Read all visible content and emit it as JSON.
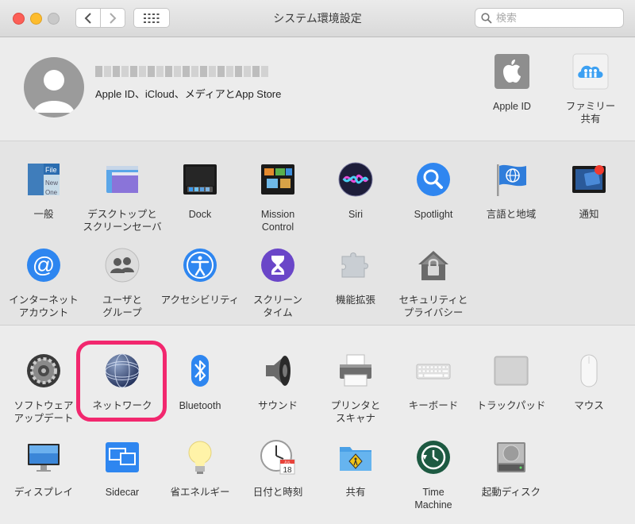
{
  "window": {
    "title": "システム環境設定"
  },
  "toolbar": {
    "search_placeholder": "検索"
  },
  "account": {
    "subtitle": "Apple ID、iCloud、メディアとApp Store",
    "items": [
      {
        "label": "Apple ID"
      },
      {
        "label": "ファミリー\n共有"
      }
    ]
  },
  "section1": [
    {
      "label": "一般"
    },
    {
      "label": "デスクトップと\nスクリーンセーバ"
    },
    {
      "label": "Dock"
    },
    {
      "label": "Mission\nControl"
    },
    {
      "label": "Siri"
    },
    {
      "label": "Spotlight"
    },
    {
      "label": "言語と地域"
    },
    {
      "label": "通知"
    },
    {
      "label": "インターネット\nアカウント"
    },
    {
      "label": "ユーザと\nグループ"
    },
    {
      "label": "アクセシビリティ"
    },
    {
      "label": "スクリーン\nタイム"
    },
    {
      "label": "機能拡張"
    },
    {
      "label": "セキュリティと\nプライバシー"
    }
  ],
  "section2": [
    {
      "label": "ソフトウェア\nアップデート"
    },
    {
      "label": "ネットワーク"
    },
    {
      "label": "Bluetooth"
    },
    {
      "label": "サウンド"
    },
    {
      "label": "プリンタと\nスキャナ"
    },
    {
      "label": "キーボード"
    },
    {
      "label": "トラックパッド"
    },
    {
      "label": "マウス"
    },
    {
      "label": "ディスプレイ"
    },
    {
      "label": "Sidecar"
    },
    {
      "label": "省エネルギー"
    },
    {
      "label": "日付と時刻"
    },
    {
      "label": "共有"
    },
    {
      "label": "Time\nMachine"
    },
    {
      "label": "起動ディスク"
    }
  ],
  "icons": {
    "general_file_text": "File",
    "general_new_text": "New",
    "general_one_text": "One",
    "calendar_month": "JUL",
    "calendar_day": "18"
  },
  "colors": {
    "highlight": "#f2276e",
    "accent_blue": "#1a82fb"
  }
}
